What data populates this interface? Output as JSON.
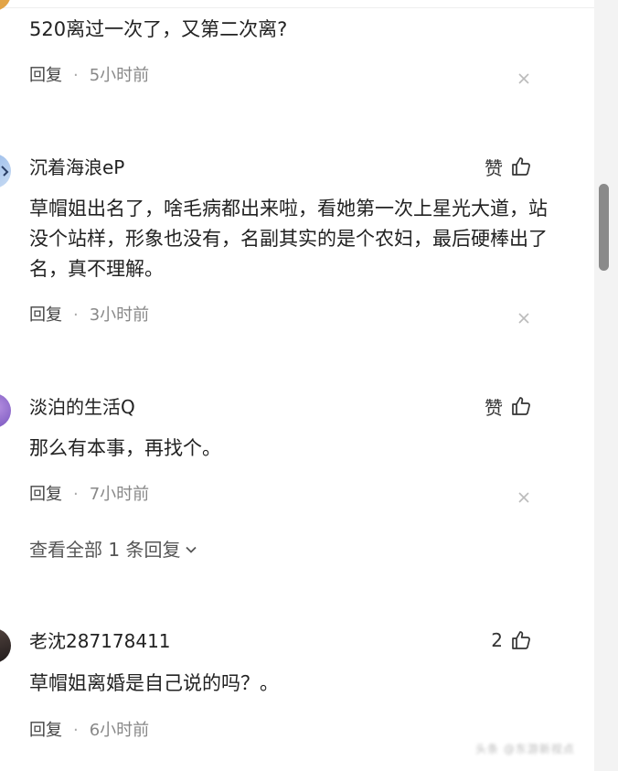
{
  "comments": [
    {
      "username": "",
      "like_label": "",
      "body": "520离过一次了，又第二次离?",
      "reply_label": "回复",
      "time": "5小时前"
    },
    {
      "username": "沉着海浪eP",
      "like_label": "赞",
      "body": "草帽姐出名了，啥毛病都出来啦，看她第一次上星光大道，站没个站样，形象也没有，名副其实的是个农妇，最后硬棒出了名，真不理解。",
      "reply_label": "回复",
      "time": "3小时前"
    },
    {
      "username": "淡泊的生活Q",
      "like_label": "赞",
      "body": "那么有本事，再找个。",
      "reply_label": "回复",
      "time": "7小时前",
      "view_all": "查看全部 1 条回复"
    },
    {
      "username": "老沈287178411",
      "like_label": "2",
      "body": "草帽姐离婚是自己说的吗？。",
      "reply_label": "回复",
      "time": "6小时前"
    }
  ],
  "watermark": "头条 @东游新视点",
  "colors": {
    "text": "#222222",
    "meta": "#888888",
    "scroll_thumb": "#8a8a8a"
  },
  "icons": [
    "thumb-up-icon",
    "close-icon",
    "chevron-down-icon"
  ]
}
